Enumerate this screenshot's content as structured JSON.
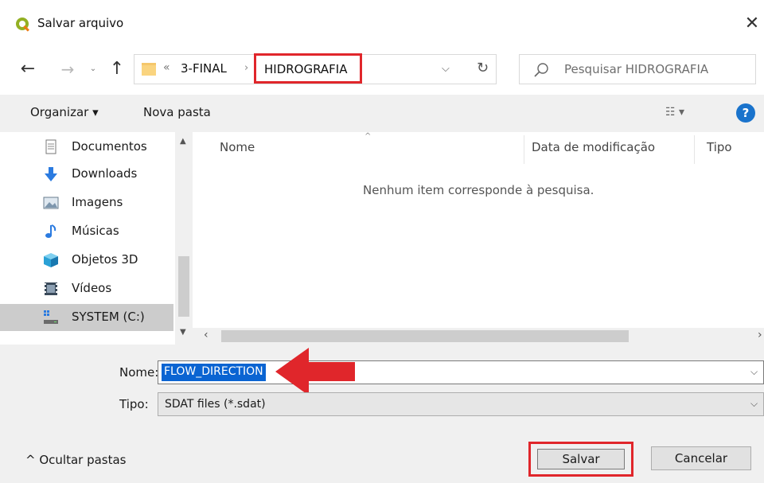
{
  "window": {
    "title": "Salvar arquivo",
    "close": "✕"
  },
  "nav": {
    "back": "←",
    "forward": "→",
    "recent": "⌄",
    "up": "↑",
    "breadcrumb_chevrons": "«",
    "crumbs": [
      "3-FINAL",
      "HIDROGRAFIA"
    ],
    "separator": "›"
  },
  "search": {
    "placeholder": "Pesquisar HIDROGRAFIA"
  },
  "toolbar": {
    "organize": "Organizar ▾",
    "new_folder": "Nova pasta",
    "view": "☷ ▾",
    "help": "?"
  },
  "sidebar": {
    "items": [
      {
        "label": "Documentos",
        "icon": "document-icon"
      },
      {
        "label": "Downloads",
        "icon": "download-icon"
      },
      {
        "label": "Imagens",
        "icon": "image-icon"
      },
      {
        "label": "Músicas",
        "icon": "music-icon"
      },
      {
        "label": "Objetos 3D",
        "icon": "cube-icon"
      },
      {
        "label": "Vídeos",
        "icon": "video-icon"
      },
      {
        "label": "SYSTEM (C:)",
        "icon": "drive-icon",
        "selected": true
      }
    ]
  },
  "file_list": {
    "columns": [
      "Nome",
      "Data de modificação",
      "Tipo"
    ],
    "sort_indicator": "^",
    "empty_message": "Nenhum item corresponde à pesquisa."
  },
  "form": {
    "name_label": "Nome:",
    "name_value": "FLOW_DIRECTION",
    "type_label": "Tipo:",
    "type_value": "SDAT files (*.sdat)"
  },
  "footer": {
    "hide_folders": "^  Ocultar pastas",
    "save": "Salvar",
    "cancel": "Cancelar"
  },
  "colors": {
    "highlight_red": "#e0262b",
    "selection_blue": "#0a64d2"
  }
}
